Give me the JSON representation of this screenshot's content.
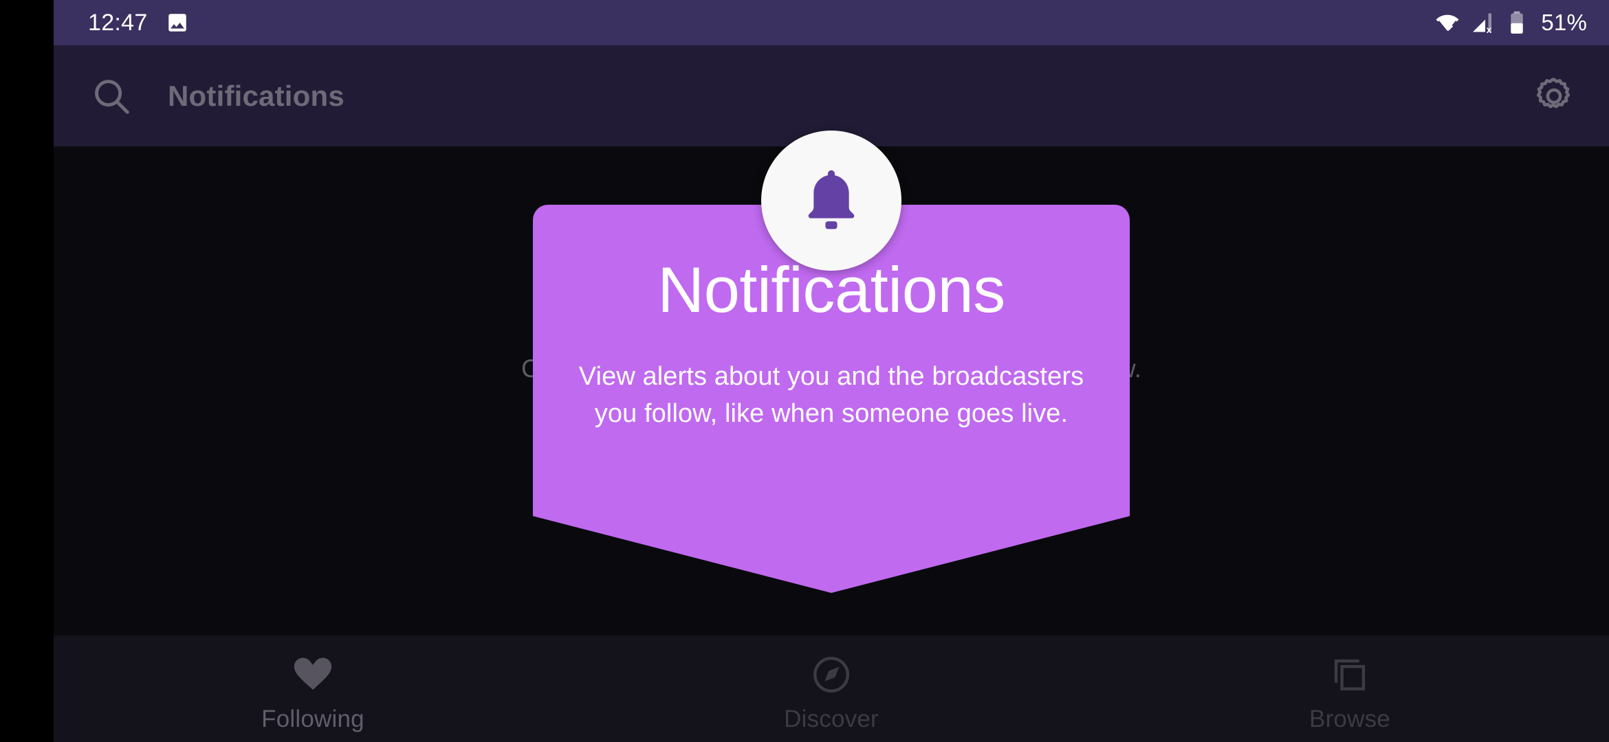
{
  "status_bar": {
    "time": "12:47",
    "battery_percent": "51%",
    "icons": {
      "screenshot": "image-icon",
      "wifi": "wifi-icon",
      "cellular": "cellular-no-service-icon",
      "battery": "battery-icon"
    },
    "background_color": "#3A3160"
  },
  "app_bar": {
    "title": "Notifications",
    "search_icon": "search-icon",
    "settings_icon": "gear-icon",
    "background_color": "#211B35",
    "text_color": "#6E6A78"
  },
  "content": {
    "empty_state_text": "Check back later for updates from channels you follow.",
    "background_color": "#0A0A0E"
  },
  "coachmark": {
    "badge_icon": "bell-icon",
    "title": "Notifications",
    "description": "View alerts about you and the broadcasters you follow, like when someone goes live.",
    "accent_color": "#C06AF0",
    "badge_background": "#F8F8F8",
    "bell_color": "#6441A5"
  },
  "bottom_nav": {
    "background_color": "#14121B",
    "items": [
      {
        "label": "Following",
        "icon": "heart-icon"
      },
      {
        "label": "Discover",
        "icon": "compass-icon"
      },
      {
        "label": "Browse",
        "icon": "cards-icon"
      }
    ]
  }
}
